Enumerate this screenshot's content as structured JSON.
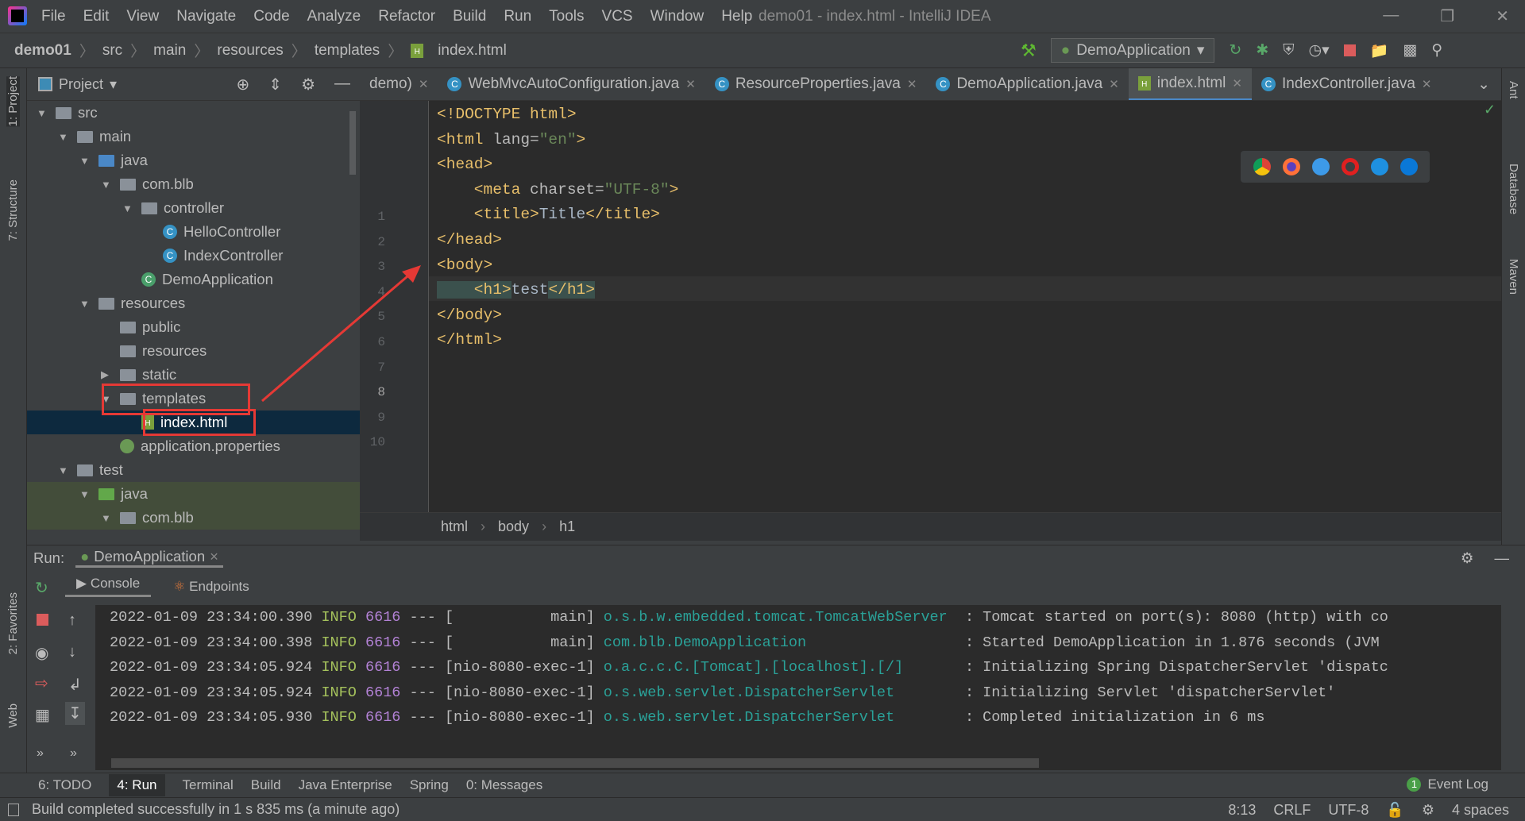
{
  "window": {
    "title": "demo01 - index.html - IntelliJ IDEA",
    "menu": [
      "File",
      "Edit",
      "View",
      "Navigate",
      "Code",
      "Analyze",
      "Refactor",
      "Build",
      "Run",
      "Tools",
      "VCS",
      "Window",
      "Help"
    ]
  },
  "navbar": {
    "crumbs": [
      "demo01",
      "src",
      "main",
      "resources",
      "templates",
      "index.html"
    ],
    "run_config": "DemoApplication"
  },
  "project": {
    "title": "Project",
    "tree": [
      {
        "label": "src",
        "depth": 0,
        "type": "folder",
        "open": true
      },
      {
        "label": "main",
        "depth": 1,
        "type": "folder",
        "open": true
      },
      {
        "label": "java",
        "depth": 2,
        "type": "folder-blue",
        "open": true
      },
      {
        "label": "com.blb",
        "depth": 3,
        "type": "package",
        "open": true
      },
      {
        "label": "controller",
        "depth": 4,
        "type": "package",
        "open": true
      },
      {
        "label": "HelloController",
        "depth": 5,
        "type": "class"
      },
      {
        "label": "IndexController",
        "depth": 5,
        "type": "class"
      },
      {
        "label": "DemoApplication",
        "depth": 4,
        "type": "springclass"
      },
      {
        "label": "resources",
        "depth": 2,
        "type": "folder",
        "open": true
      },
      {
        "label": "public",
        "depth": 3,
        "type": "folder"
      },
      {
        "label": "resources",
        "depth": 3,
        "type": "folder"
      },
      {
        "label": "static",
        "depth": 3,
        "type": "folder",
        "open": false
      },
      {
        "label": "templates",
        "depth": 3,
        "type": "folder",
        "open": true,
        "highlighted": true
      },
      {
        "label": "index.html",
        "depth": 4,
        "type": "html",
        "selected": true,
        "highlighted": true
      },
      {
        "label": "application.properties",
        "depth": 3,
        "type": "props"
      },
      {
        "label": "test",
        "depth": 1,
        "type": "folder",
        "open": true
      },
      {
        "label": "java",
        "depth": 2,
        "type": "folder-green",
        "open": true,
        "test": true
      },
      {
        "label": "com.blb",
        "depth": 3,
        "type": "package",
        "open": true,
        "test": true
      }
    ]
  },
  "tabs": [
    {
      "label": "demo)"
    },
    {
      "label": "WebMvcAutoConfiguration.java"
    },
    {
      "label": "ResourceProperties.java"
    },
    {
      "label": "DemoApplication.java"
    },
    {
      "label": "index.html",
      "active": true
    },
    {
      "label": "IndexController.java"
    }
  ],
  "editor": {
    "current_line": 8,
    "lines": [
      [
        {
          "t": "<!DOCTYPE html>",
          "c": "tag"
        }
      ],
      [
        {
          "t": "<html ",
          "c": "tag"
        },
        {
          "t": "lang=",
          "c": "attr"
        },
        {
          "t": "\"en\"",
          "c": "str"
        },
        {
          "t": ">",
          "c": "tag"
        }
      ],
      [
        {
          "t": "<head>",
          "c": "tag"
        }
      ],
      [
        {
          "t": "    <meta ",
          "c": "tag"
        },
        {
          "t": "charset=",
          "c": "attr"
        },
        {
          "t": "\"UTF-8\"",
          "c": "str"
        },
        {
          "t": ">",
          "c": "tag"
        }
      ],
      [
        {
          "t": "    <title>",
          "c": "tag"
        },
        {
          "t": "Title",
          "c": "txt"
        },
        {
          "t": "</title>",
          "c": "tag"
        }
      ],
      [
        {
          "t": "</head>",
          "c": "tag"
        }
      ],
      [
        {
          "t": "<body>",
          "c": "tag"
        }
      ],
      [
        {
          "t": "    <h1>",
          "c": "tag"
        },
        {
          "t": "test",
          "c": "txt"
        },
        {
          "t": "</h1>",
          "c": "tag"
        }
      ],
      [
        {
          "t": "</body>",
          "c": "tag"
        }
      ],
      [
        {
          "t": "</html>",
          "c": "tag"
        }
      ]
    ],
    "breadcrumb": [
      "html",
      "body",
      "h1"
    ]
  },
  "left_strip": [
    "1: Project",
    "7: Structure",
    "2: Favorites",
    "Web"
  ],
  "right_strip": [
    "Ant",
    "Database",
    "Maven"
  ],
  "run": {
    "label": "Run:",
    "config": "DemoApplication",
    "tabs": [
      "Console",
      "Endpoints"
    ],
    "log": [
      {
        "ts": "2022-01-09 23:34:00.390",
        "level": "INFO",
        "pid": "6616",
        "sep": "---",
        "thread": "[           main]",
        "logger": "o.s.b.w.embedded.tomcat.TomcatWebServer ",
        "msg": ": Tomcat started on port(s): 8080 (http) with co"
      },
      {
        "ts": "2022-01-09 23:34:00.398",
        "level": "INFO",
        "pid": "6616",
        "sep": "---",
        "thread": "[           main]",
        "logger": "com.blb.DemoApplication                 ",
        "msg": ": Started DemoApplication in 1.876 seconds (JVM"
      },
      {
        "ts": "2022-01-09 23:34:05.924",
        "level": "INFO",
        "pid": "6616",
        "sep": "---",
        "thread": "[nio-8080-exec-1]",
        "logger": "o.a.c.c.C.[Tomcat].[localhost].[/]      ",
        "msg": ": Initializing Spring DispatcherServlet 'dispatc"
      },
      {
        "ts": "2022-01-09 23:34:05.924",
        "level": "INFO",
        "pid": "6616",
        "sep": "---",
        "thread": "[nio-8080-exec-1]",
        "logger": "o.s.web.servlet.DispatcherServlet       ",
        "msg": ": Initializing Servlet 'dispatcherServlet'"
      },
      {
        "ts": "2022-01-09 23:34:05.930",
        "level": "INFO",
        "pid": "6616",
        "sep": "---",
        "thread": "[nio-8080-exec-1]",
        "logger": "o.s.web.servlet.DispatcherServlet       ",
        "msg": ": Completed initialization in 6 ms"
      }
    ]
  },
  "bottom_tools": [
    "6: TODO",
    "4: Run",
    "Terminal",
    "Build",
    "Java Enterprise",
    "Spring",
    "0: Messages"
  ],
  "event_log": {
    "label": "Event Log",
    "count": "1"
  },
  "status": {
    "message": "Build completed successfully in 1 s 835 ms (a minute ago)",
    "position": "8:13",
    "line_sep": "CRLF",
    "encoding": "UTF-8",
    "indent": "4 spaces"
  }
}
